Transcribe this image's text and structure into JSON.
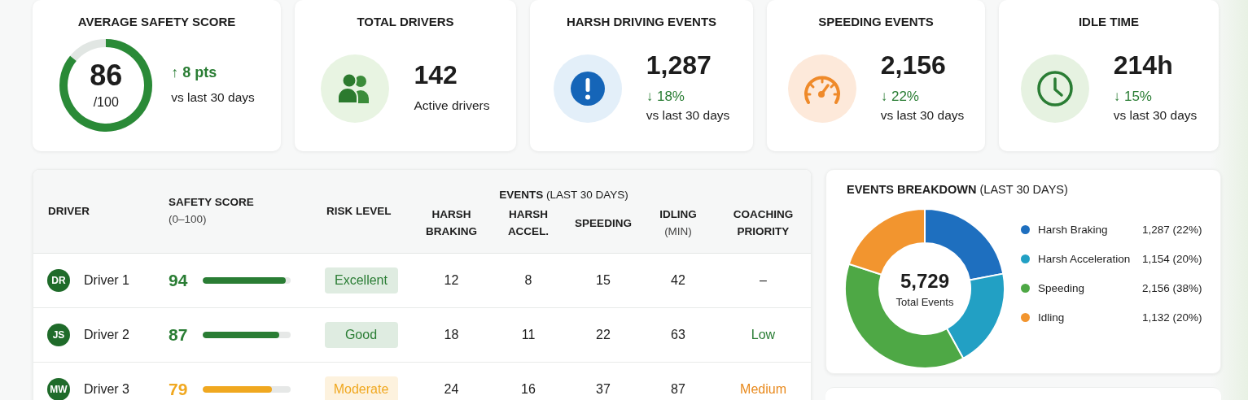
{
  "kpis": [
    {
      "kind": "ring",
      "title": "AVERAGE SAFETY SCORE",
      "value": "86",
      "unit": "/100",
      "level": 0.86,
      "delta": "↑ 8 pts",
      "note": "vs last 30 days"
    },
    {
      "kind": "people",
      "title": "TOTAL DRIVERS",
      "value": "142",
      "note": "Active drivers"
    },
    {
      "kind": "alert",
      "title": "HARSH DRIVING EVENTS",
      "value": "1,287",
      "delta": "↓ 18%",
      "note": "vs last 30 days"
    },
    {
      "kind": "speed",
      "title": "SPEEDING EVENTS",
      "value": "2,156",
      "delta": "↓ 22%",
      "note": "vs last 30 days"
    },
    {
      "kind": "clock",
      "title": "IDLE TIME",
      "value": "214h",
      "delta": "↓ 15%",
      "note": "vs last 30 days"
    }
  ],
  "table": {
    "group_header": "**EVENTS** (LAST 30 DAYS)",
    "columns": [
      {
        "label": "DRIVER"
      },
      {
        "label": "SAFETY SCORE",
        "sub": "(0–100)"
      },
      {
        "label": "RISK LEVEL"
      },
      {
        "label": "HARSH BRAKING"
      },
      {
        "label": "HARSH ACCEL."
      },
      {
        "label": "SPEEDING"
      },
      {
        "label": "IDLING",
        "sub": "(MIN)"
      },
      {
        "label": "COACHING PRIORITY"
      }
    ],
    "rows": [
      {
        "initials": "DR",
        "driver": "Driver 1",
        "score": "94",
        "level": 0.94,
        "risk": "Excellent",
        "color": "#2a7d34",
        "harsh_braking": "12",
        "harsh_accel": "8",
        "speeding": "15",
        "idling": "42",
        "priority": {
          "label": "–",
          "color": "#222222"
        }
      },
      {
        "initials": "JS",
        "driver": "Driver 2",
        "score": "87",
        "level": 0.87,
        "risk": "Good",
        "color": "#2a7d34",
        "harsh_braking": "18",
        "harsh_accel": "11",
        "speeding": "22",
        "idling": "63",
        "priority": {
          "label": "Low",
          "color": "#2a7d34"
        }
      },
      {
        "initials": "MW",
        "driver": "Driver 3",
        "score": "79",
        "level": 0.79,
        "risk": "Moderate",
        "color": "#f0a820",
        "harsh_braking": "24",
        "harsh_accel": "16",
        "speeding": "37",
        "idling": "87",
        "priority": {
          "label": "Medium",
          "color": "#e8891c"
        }
      }
    ]
  },
  "breakdown": {
    "title": "**EVENTS BREAKDOWN** (LAST 30 DAYS)",
    "total": "5,729",
    "total_label": "Total Events",
    "chart_data": {
      "type": "donut",
      "series": [
        {
          "values": [
            22,
            20,
            38,
            20
          ]
        }
      ]
    },
    "legend": [
      {
        "label": "Harsh Braking",
        "value": "1,287 (22%)",
        "color": "#1e6fbf"
      },
      {
        "label": "Harsh Acceleration",
        "value": "1,154 (20%)",
        "color": "#22a0c4"
      },
      {
        "label": "Speeding",
        "value": "2,156 (38%)",
        "color": "#4ea845"
      },
      {
        "label": "Idling",
        "value": "1,132 (20%)",
        "color": "#f2952f"
      }
    ]
  }
}
